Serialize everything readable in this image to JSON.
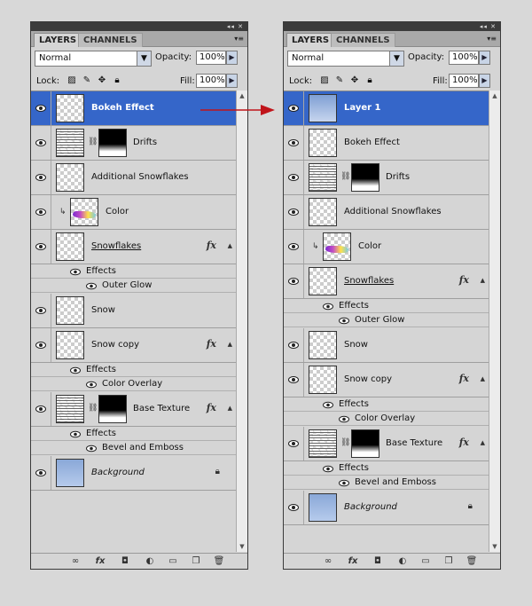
{
  "tabs": {
    "layers": "LAYERS",
    "channels": "CHANNELS"
  },
  "controls": {
    "blend_mode": "Normal",
    "opacity_label": "Opacity:",
    "opacity_value": "100%",
    "lock_label": "Lock:",
    "fill_label": "Fill:",
    "fill_value": "100%"
  },
  "effects_label": "Effects",
  "left_panel": {
    "layers": [
      {
        "name": "Bokeh Effect",
        "selected": true
      },
      {
        "name": "Drifts"
      },
      {
        "name": "Additional Snowflakes"
      },
      {
        "name": "Color"
      },
      {
        "name": "Snowflakes",
        "effect": "Outer Glow"
      },
      {
        "name": "Snow"
      },
      {
        "name": "Snow copy",
        "effect": "Color Overlay"
      },
      {
        "name": "Base Texture",
        "effect": "Bevel and Emboss"
      },
      {
        "name": "Background"
      }
    ]
  },
  "right_panel": {
    "layers": [
      {
        "name": "Layer 1",
        "selected": true
      },
      {
        "name": "Bokeh Effect"
      },
      {
        "name": "Drifts"
      },
      {
        "name": "Additional Snowflakes"
      },
      {
        "name": "Color"
      },
      {
        "name": "Snowflakes",
        "effect": "Outer Glow"
      },
      {
        "name": "Snow"
      },
      {
        "name": "Snow copy",
        "effect": "Color Overlay"
      },
      {
        "name": "Base Texture",
        "effect": "Bevel and Emboss"
      },
      {
        "name": "Background"
      }
    ]
  },
  "icons": {
    "fx": "fx",
    "arrow_color": "#c0141a",
    "selection_color": "#3566c9"
  }
}
